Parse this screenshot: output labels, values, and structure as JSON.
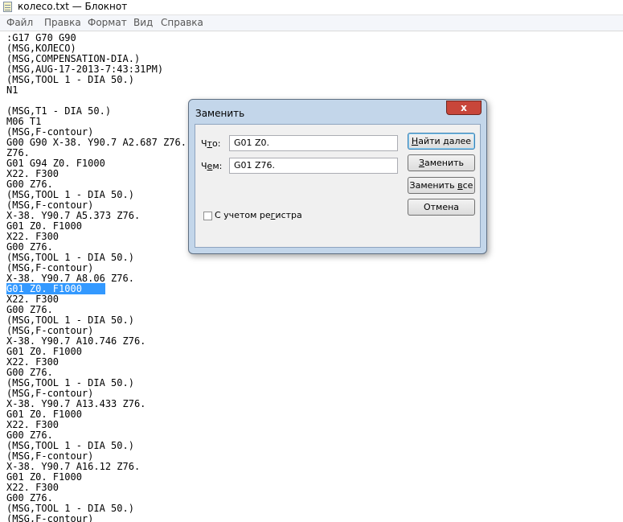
{
  "window": {
    "title": "колесо.txt — Блокнот"
  },
  "menu": [
    "Файл",
    "Правка",
    "Формат",
    "Вид",
    "Справка"
  ],
  "editor": {
    "selected_line_index": 24,
    "lines": [
      ":G17 G70 G90",
      "(MSG,КОЛЕСО)",
      "(MSG,COMPENSATION-DIA.)",
      "(MSG,AUG-17-2013-7:43:31PM)",
      "(MSG,TOOL 1 - DIA 50.)",
      "N1",
      "",
      "(MSG,T1 - DIA 50.)",
      "M06 T1",
      "(MSG,F-contour)",
      "G00 G90 X-38. Y90.7 A2.687 Z76.",
      "Z76.",
      "G01 G94 Z0. F1000",
      "X22. F300",
      "G00 Z76.",
      "(MSG,TOOL 1 - DIA 50.)",
      "(MSG,F-contour)",
      "X-38. Y90.7 A5.373 Z76.",
      "G01 Z0. F1000",
      "X22. F300",
      "G00 Z76.",
      "(MSG,TOOL 1 - DIA 50.)",
      "(MSG,F-contour)",
      "X-38. Y90.7 A8.06 Z76.",
      "G01 Z0. F1000",
      "X22. F300",
      "G00 Z76.",
      "(MSG,TOOL 1 - DIA 50.)",
      "(MSG,F-contour)",
      "X-38. Y90.7 A10.746 Z76.",
      "G01 Z0. F1000",
      "X22. F300",
      "G00 Z76.",
      "(MSG,TOOL 1 - DIA 50.)",
      "(MSG,F-contour)",
      "X-38. Y90.7 A13.433 Z76.",
      "G01 Z0. F1000",
      "X22. F300",
      "G00 Z76.",
      "(MSG,TOOL 1 - DIA 50.)",
      "(MSG,F-contour)",
      "X-38. Y90.7 A16.12 Z76.",
      "G01 Z0. F1000",
      "X22. F300",
      "G00 Z76.",
      "(MSG,TOOL 1 - DIA 50.)",
      "(MSG,F-contour)"
    ]
  },
  "dialog": {
    "title": "Заменить",
    "close_glyph": "x",
    "find_label_pre": "Ч",
    "find_label_ul": "т",
    "find_label_post": "о:",
    "find_value": "G01 Z0.",
    "replace_label_pre": "Ч",
    "replace_label_ul": "е",
    "replace_label_post": "м:",
    "replace_value": "G01 Z76.",
    "find_next_pre": "",
    "find_next_ul": "Н",
    "find_next_post": "айти далее",
    "replace_pre": "",
    "replace_ul": "З",
    "replace_post": "аменить",
    "replace_all_pre": "Заменить ",
    "replace_all_ul": "в",
    "replace_all_post": "се",
    "cancel": "Отмена",
    "match_case_pre": "С учетом ре",
    "match_case_ul": "г",
    "match_case_post": "истра",
    "match_case_checked": false
  }
}
